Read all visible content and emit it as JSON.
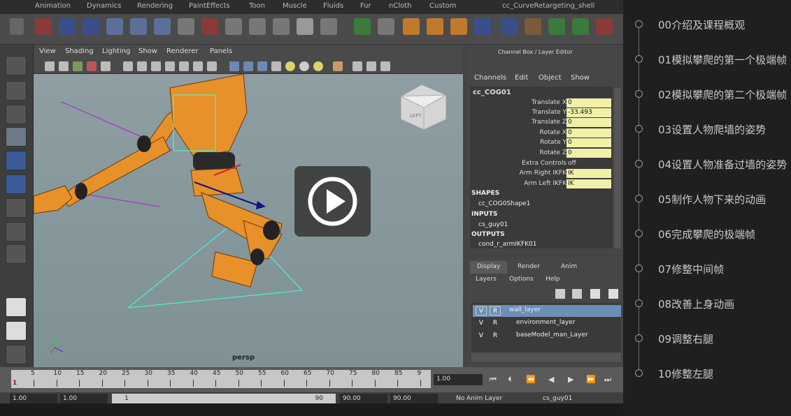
{
  "maya": {
    "top_tabs": [
      "Animation",
      "Dynamics",
      "Rendering",
      "PaintEffects",
      "Toon",
      "Muscle",
      "Fluids",
      "Fur",
      "nCloth",
      "Custom",
      "cc_CurveRetargeting_shell"
    ],
    "viewport_menu": [
      "View",
      "Shading",
      "Lighting",
      "Show",
      "Renderer",
      "Panels"
    ],
    "view_cube_label": "LEFT",
    "camera_label": "persp",
    "channel_box": {
      "title": "Channel Box / Layer Editor",
      "menu": [
        "Channels",
        "Edit",
        "Object",
        "Show"
      ],
      "node": "cc_COG01",
      "attributes": [
        {
          "label": "Translate X",
          "value": "0"
        },
        {
          "label": "Translate Y",
          "value": "-33.493"
        },
        {
          "label": "Translate Z",
          "value": "0"
        },
        {
          "label": "Rotate X",
          "value": "0"
        },
        {
          "label": "Rotate Y",
          "value": "0"
        },
        {
          "label": "Rotate Z",
          "value": "0"
        },
        {
          "label": "Extra Controls",
          "value": "off"
        },
        {
          "label": "Arm Right IKFK",
          "value": "IK"
        },
        {
          "label": "Arm Left IKFK",
          "value": "IK"
        }
      ],
      "shapes_header": "SHAPES",
      "shape_item": "cc_COG0Shape1",
      "inputs_header": "INPUTS",
      "input_item": "cs_guy01",
      "outputs_header": "OUTPUTS",
      "output_item": "cond_r_armIKFK01"
    },
    "layer_editor": {
      "tabs": [
        "Display",
        "Render",
        "Anim"
      ],
      "menu": [
        "Layers",
        "Options",
        "Help"
      ],
      "layers": [
        {
          "v": "V",
          "r": "R",
          "name": "wall_layer"
        },
        {
          "v": "V",
          "r": "R",
          "name": "environment_layer"
        },
        {
          "v": "V",
          "r": "R",
          "name": "baseModel_man_Layer"
        }
      ]
    },
    "timeline": {
      "ticks": [
        "5",
        "10",
        "15",
        "20",
        "25",
        "30",
        "35",
        "40",
        "45",
        "50",
        "55",
        "60",
        "65",
        "70",
        "75",
        "80",
        "85",
        "9"
      ],
      "current_frame": "1",
      "current_field": "1.00"
    },
    "range_bar": {
      "start": "1.00",
      "start2": "1.00",
      "slider_start": "1",
      "slider_end": "90",
      "end": "90.00",
      "end2": "90.00",
      "anim_layer": "No Anim Layer",
      "character": "cs_guy01"
    }
  },
  "lessons": [
    "00介绍及课程概观",
    "01模拟攀爬的第一个极端帧",
    "02模拟攀爬的第二个极端帧",
    "03设置人物爬墙的姿势",
    "04设置人物准备过墙的姿势",
    "05制作人物下来的动画",
    "06完成攀爬的极端帧",
    "07修整中间帧",
    "08改善上身动画",
    "09调整右腿",
    "10修整左腿"
  ]
}
